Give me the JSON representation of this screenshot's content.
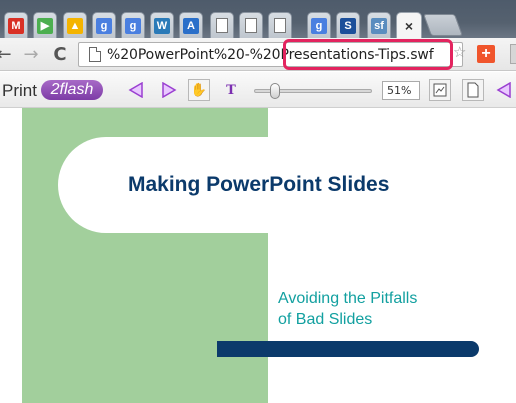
{
  "tabs": [
    {
      "name": "gmail-tab",
      "icon": "gmail-icon",
      "glyph": "M",
      "color": "#d93025"
    },
    {
      "name": "play-tab",
      "icon": "play-icon",
      "glyph": "▶",
      "color": "#4caf50"
    },
    {
      "name": "drive-tab",
      "icon": "drive-icon",
      "glyph": "▲",
      "color": "#f4b400"
    },
    {
      "name": "google-tab-1",
      "icon": "google-icon",
      "glyph": "g",
      "color": "#4a7fe0"
    },
    {
      "name": "google-tab-2",
      "icon": "google-icon",
      "glyph": "g",
      "color": "#4a7fe0"
    },
    {
      "name": "w-tab",
      "icon": "w-icon",
      "glyph": "W",
      "color": "#2a7ab8"
    },
    {
      "name": "adwords-tab",
      "icon": "adwords-icon",
      "glyph": "A",
      "color": "#2a6fc9"
    },
    {
      "name": "blank-tab-1",
      "icon": "page-icon",
      "glyph": "",
      "color": "#ffffff"
    },
    {
      "name": "blank-tab-2",
      "icon": "page-icon",
      "glyph": "",
      "color": "#ffffff"
    },
    {
      "name": "blank-tab-3",
      "icon": "page-icon",
      "glyph": "",
      "color": "#ffffff"
    },
    {
      "name": "google-tab-3",
      "icon": "google-icon",
      "glyph": "g",
      "color": "#4a7fe0"
    },
    {
      "name": "s-tab",
      "icon": "s-icon",
      "glyph": "S",
      "color": "#1b4f9a"
    },
    {
      "name": "sf-tab",
      "icon": "sf-icon",
      "glyph": "sf",
      "color": "#5a8dbf"
    }
  ],
  "active_tab_close": "×",
  "nav": {
    "back": "←",
    "forward": "→",
    "reload": "C",
    "url": "%20PowerPoint%20-%20Presentations-Tips.swf",
    "star": "☆",
    "extension": "+"
  },
  "toolbar": {
    "print_label": "Print",
    "logo_text": "2flash",
    "zoom_value": "51%"
  },
  "slide": {
    "title": "Making PowerPoint Slides",
    "subtitle_line1": "Avoiding the Pitfalls",
    "subtitle_line2": "of Bad Slides"
  },
  "colors": {
    "accent_highlight": "#e3245f",
    "slide_green": "#a2cf9c",
    "title_navy": "#0b3a6b",
    "subtitle_teal": "#12a0a0"
  }
}
